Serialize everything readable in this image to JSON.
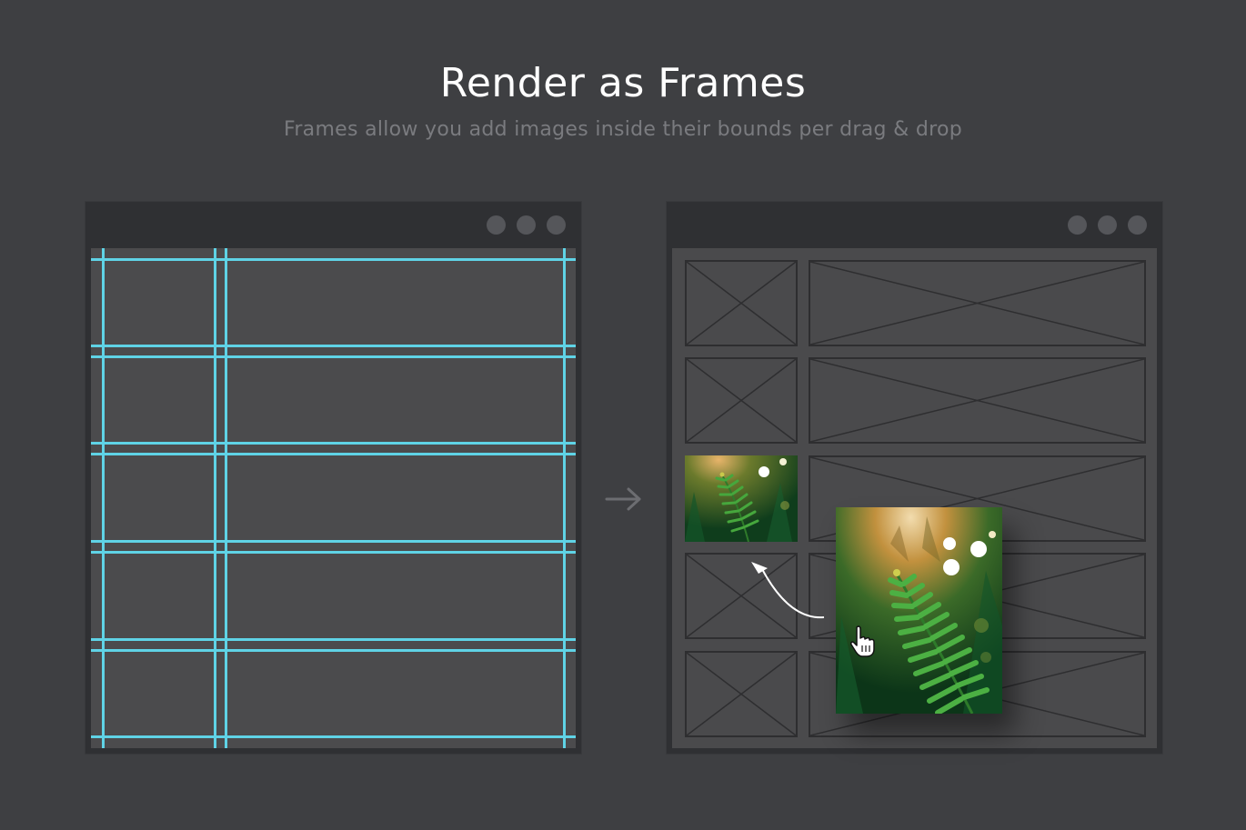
{
  "heading": {
    "title": "Render as Frames",
    "subtitle": "Frames allow you add images inside their bounds per drag & drop"
  },
  "left_window": {
    "titlebar_dots": 3,
    "guide_color": "#5fd3e6",
    "content": "guides-grid"
  },
  "right_window": {
    "titlebar_dots": 3,
    "frame_rows": 5,
    "frame_columns": 2,
    "filled_frame": {
      "row": 3,
      "column": 1,
      "image": "fern-photo"
    }
  },
  "colors": {
    "background": "#3e3f42",
    "window_chrome": "#2f3033",
    "canvas": "#4b4b4d",
    "titlebar_dot": "#55565a",
    "guide": "#5fd3e6",
    "frame_stroke": "#2e2e30"
  },
  "icons": {
    "transition": "arrow-right-icon",
    "pointer": "hand-cursor-icon",
    "drag_path": "curved-arrow-icon"
  }
}
